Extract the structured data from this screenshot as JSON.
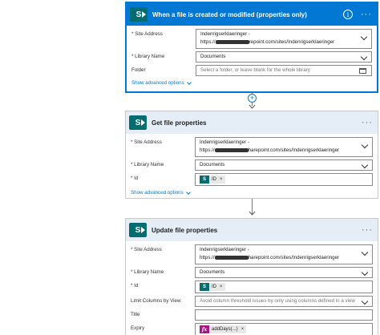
{
  "cards": {
    "trigger": {
      "title": "When a file is created or modified (properties only)",
      "site_label": "* Site Address",
      "site_line1": "Indenrigserklaeringer -",
      "site_line2_prefix": "https://",
      "site_line2_suffix": "repoint.com/sites/Indenrigserklaeringer",
      "library_label": "* Library Name",
      "library_value": "Documents",
      "folder_label": "Folder",
      "folder_placeholder": "Select a folder, or leave blank for the whole library",
      "show_advanced": "Show advanced options"
    },
    "get": {
      "title": "Get file properties",
      "site_label": "* Site Address",
      "site_line1": "Indenrigserklaeringer -",
      "site_line2_prefix": "https://",
      "site_line2_suffix": "harepoint.com/sites/Indenrigserklaeringer",
      "library_label": "* Library Name",
      "library_value": "Documents",
      "id_label": "* Id",
      "id_token": "ID",
      "show_advanced": "Show advanced options"
    },
    "update": {
      "title": "Update file properties",
      "site_label": "* Site Address",
      "site_line1": "Indenrigserklaeringer -",
      "site_line2_prefix": "https://",
      "site_line2_suffix": "harepoint.com/sites/Indenrigserklaeringer",
      "library_label": "* Library Name",
      "library_value": "Documents",
      "id_label": "* Id",
      "id_token": "ID",
      "limit_label": "Limit Columns by View",
      "limit_value": "Avoid column threshold issues by only using columns defined in a view",
      "title_label": "Title",
      "expiry_label": "Expiry",
      "expiry_token": "addDays(...)"
    }
  },
  "icons": {
    "sharepoint": "sharepoint-icon",
    "info": "info-icon",
    "more": "more-options-icon",
    "chevron": "chevron-down-icon",
    "folder": "folder-icon",
    "plus": "add-step-icon",
    "arrow": "arrow-down-icon",
    "token_remove": "close-icon",
    "expression": "expression-icon"
  },
  "colors": {
    "accent": "#0078d4",
    "sharepoint": "#036c70",
    "expression": "#a4198a",
    "header_grey": "#e5eef6"
  }
}
